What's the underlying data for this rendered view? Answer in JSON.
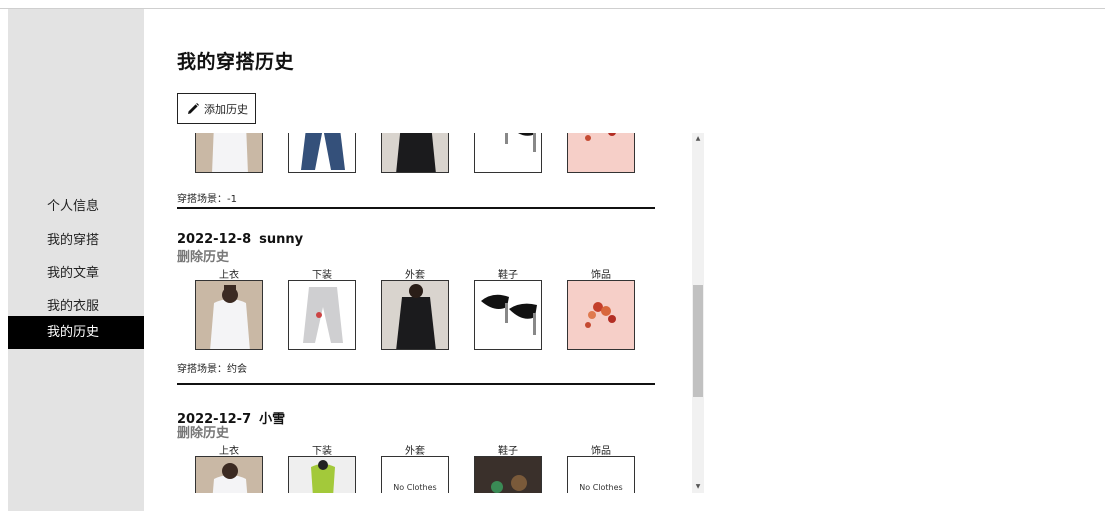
{
  "sidebar": {
    "items": [
      {
        "label": "个人信息",
        "active": false
      },
      {
        "label": "我的穿搭",
        "active": false
      },
      {
        "label": "我的文章",
        "active": false
      },
      {
        "label": "我的衣服",
        "active": false
      },
      {
        "label": "我的历史",
        "active": true
      }
    ]
  },
  "page": {
    "title": "我的穿搭历史",
    "add_button_label": "添加历史"
  },
  "categories": [
    "上衣",
    "下装",
    "外套",
    "鞋子",
    "饰品"
  ],
  "no_clothes_text": "No Clothes",
  "history": [
    {
      "date": "",
      "user": "",
      "scene_label": "穿搭场景：",
      "scene": "-1",
      "items": [
        "white-shirt",
        "jeans",
        "black-coat",
        "black-heels",
        "bracelet"
      ]
    },
    {
      "date": "2022-12-8",
      "user": "sunny",
      "delete_label": "删除历史",
      "scene_label": "穿搭场景：",
      "scene": "约会",
      "items": [
        "white-shirt",
        "grey-pants",
        "black-coat",
        "black-heels",
        "bracelet"
      ]
    },
    {
      "date": "2022-12-7",
      "user": "小雪",
      "delete_label": "删除历史",
      "items": [
        "white-shirt",
        "green-top",
        "no-clothes",
        "shoes-photo",
        "no-clothes"
      ]
    }
  ]
}
